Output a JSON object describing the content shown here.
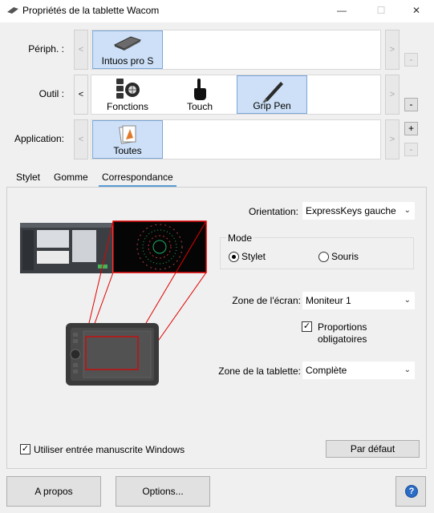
{
  "window": {
    "title": "Propriétés de la tablette Wacom",
    "minimize_glyph": "—",
    "maximize_glyph": "☐",
    "close_glyph": "✕"
  },
  "device_row": {
    "label": "Périph. :",
    "prev_glyph": "<",
    "next_glyph": ">",
    "items": [
      {
        "label": "Intuos pro S",
        "icon": "tablet-icon",
        "selected": true
      }
    ],
    "remove_glyph": "-"
  },
  "tool_row": {
    "label": "Outil :",
    "prev_glyph": "<",
    "next_glyph": ">",
    "items": [
      {
        "label": "Fonctions",
        "icon": "functions-icon",
        "selected": false
      },
      {
        "label": "Touch",
        "icon": "touch-hand-icon",
        "selected": false
      },
      {
        "label": "Grip Pen",
        "icon": "pen-icon",
        "selected": true
      }
    ],
    "remove_glyph": "-"
  },
  "app_row": {
    "label": "Application:",
    "prev_glyph": "<",
    "next_glyph": ">",
    "items": [
      {
        "label": "Toutes",
        "icon": "all-apps-icon",
        "selected": true
      }
    ],
    "add_glyph": "+",
    "remove_glyph": "-"
  },
  "tabs": [
    {
      "label": "Stylet",
      "active": false
    },
    {
      "label": "Gomme",
      "active": false
    },
    {
      "label": "Correspondance",
      "active": true
    }
  ],
  "mapping": {
    "orientation_label": "Orientation:",
    "orientation_value": "ExpressKeys gauche",
    "mode_title": "Mode",
    "mode_options": [
      {
        "label": "Stylet",
        "checked": true
      },
      {
        "label": "Souris",
        "checked": false
      }
    ],
    "screen_area_label": "Zone de l'écran:",
    "screen_area_value": "Moniteur 1",
    "proportions_label_line1": "Proportions",
    "proportions_label_line2": "obligatoires",
    "proportions_checked": true,
    "tablet_area_label": "Zone de la tablette:",
    "tablet_area_value": "Complète",
    "windows_ink_label": "Utiliser entrée manuscrite Windows",
    "windows_ink_checked": true,
    "default_button": "Par défaut",
    "check_glyph": "✓",
    "chevron_glyph": "⌄",
    "highlight_color": "#e00000"
  },
  "footer": {
    "about_button": "A propos",
    "options_button": "Options...",
    "help_glyph": "?"
  }
}
